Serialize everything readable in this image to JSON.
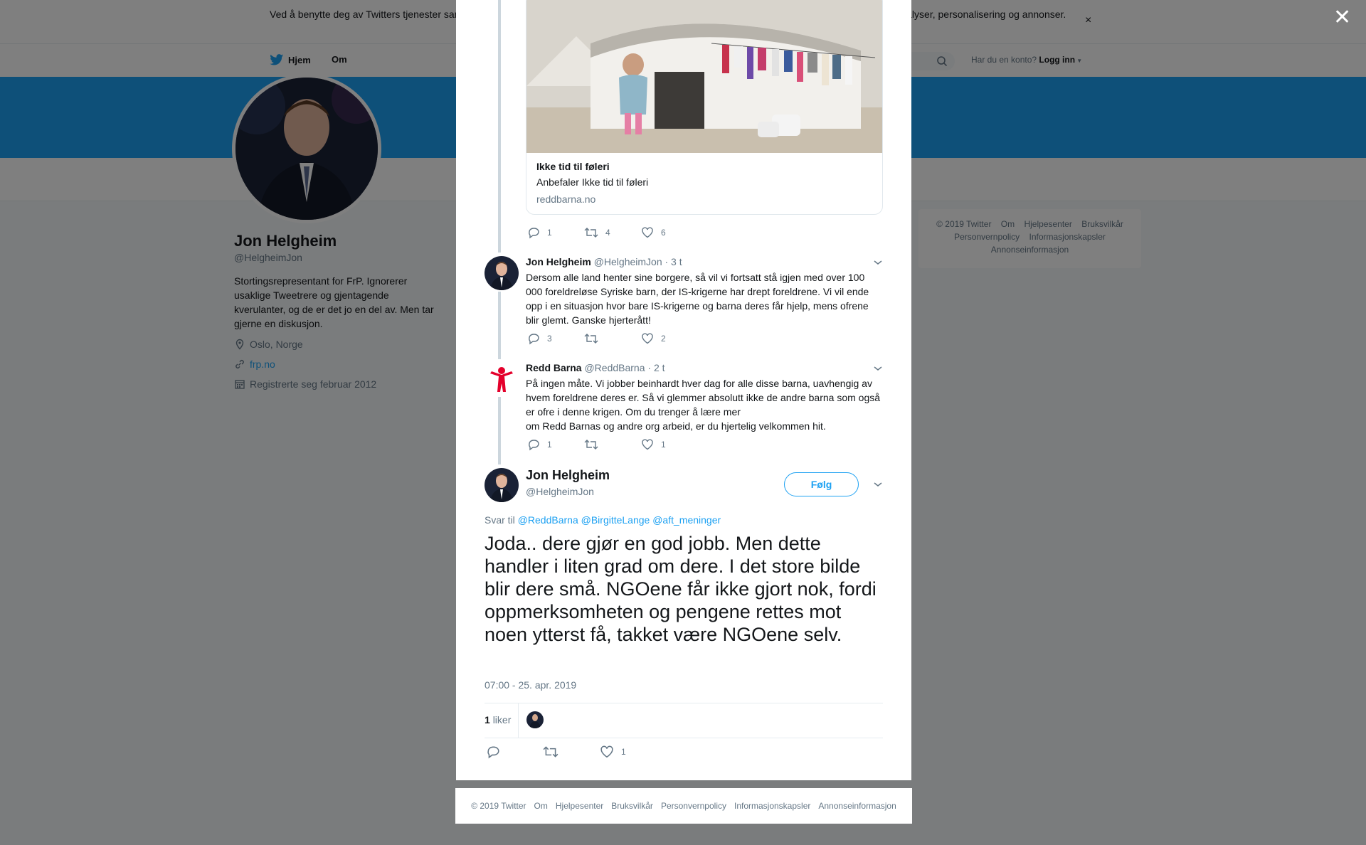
{
  "cookie_bar": {
    "text": "Ved å benytte deg av Twitters tjenester samtykker du til bruken av informasjonskapsler. Twitter og partnere bruker informasjonskapsler til bl.a. analyser, personalisering og annonser.",
    "close": "×"
  },
  "nav": {
    "home": "Hjem",
    "about": "Om",
    "account_prompt": "Har du en konto?",
    "login": "Logg inn"
  },
  "profile": {
    "name": "Jon Helgheim",
    "handle": "@HelgheimJon",
    "bio": "Stortingsrepresentant for FrP. Ignorerer usaklige Tweetrere og gjentagende kverulanter, og de er det jo en del av. Men tar gjerne en diskusjon.",
    "location": "Oslo, Norge",
    "website": "frp.no",
    "joined": "Registrerte seg februar 2012"
  },
  "right_footer": [
    "© 2019 Twitter",
    "Om",
    "Hjelpesenter",
    "Bruksvilkår",
    "Personvernpolicy",
    "Informasjonskapsler",
    "Annonseinformasjon"
  ],
  "overlay_close": "✕",
  "card": {
    "title": "Ikke tid til føleri",
    "description": "Anbefaler Ikke tid til føleri",
    "domain": "reddbarna.no"
  },
  "card_actions": {
    "replies": "1",
    "retweets": "4",
    "likes": "6"
  },
  "tweets": [
    {
      "name": "Jon Helgheim",
      "handle": "@HelgheimJon",
      "time": "· 3 t",
      "text": "Dersom alle land henter sine borgere, så vil vi fortsatt stå igjen med over 100 000 foreldreløse Syriske barn, der IS-krigerne har drept foreldrene. Vi vil ende opp i en situasjon hvor bare IS-krigerne og barna deres får hjelp, mens ofrene blir glemt. Ganske hjerterått!",
      "replies": "3",
      "retweets": "",
      "likes": "2"
    },
    {
      "name": "Redd Barna",
      "handle": "@ReddBarna",
      "time": "· 2 t",
      "text": "På ingen måte. Vi jobber beinhardt hver dag for alle disse barna, uavhengig av hvem foreldrene deres er. Så vi glemmer absolutt ikke de andre barna som også er ofre i denne krigen. Om du trenger å lære mer",
      "text2": "om Redd Barnas og andre org arbeid, er du hjertelig velkommen hit.",
      "replies": "1",
      "retweets": "",
      "likes": "1"
    }
  ],
  "main_tweet": {
    "name": "Jon Helgheim",
    "handle": "@HelgheimJon",
    "follow": "Følg",
    "reply_prefix": "Svar til",
    "mentions": "@ReddBarna @BirgitteLange @aft_meninger",
    "text": "Joda.. dere gjør en god jobb. Men dette handler i liten grad om dere. I det store bilde blir dere små. NGOene får ikke gjort nok, fordi oppmerksomheten og pengene rettes mot noen ytterst få, takket være NGOene selv.",
    "timestamp": "07:00 - 25. apr. 2019",
    "like_count": "1",
    "like_label": "liker",
    "replies": "",
    "retweets": "",
    "likes": "1"
  },
  "modal_footer": [
    "© 2019 Twitter",
    "Om",
    "Hjelpesenter",
    "Bruksvilkår",
    "Personvernpolicy",
    "Informasjonskapsler",
    "Annonseinformasjon"
  ],
  "colors": {
    "brand": "#1da1f2",
    "muted": "#657786",
    "reddbarna": "#e4002b"
  },
  "icons": [
    "twitter-bird-icon",
    "search-icon",
    "location-icon",
    "link-icon",
    "calendar-icon",
    "reply-icon",
    "retweet-icon",
    "like-icon",
    "chevron-down-icon",
    "close-icon"
  ]
}
